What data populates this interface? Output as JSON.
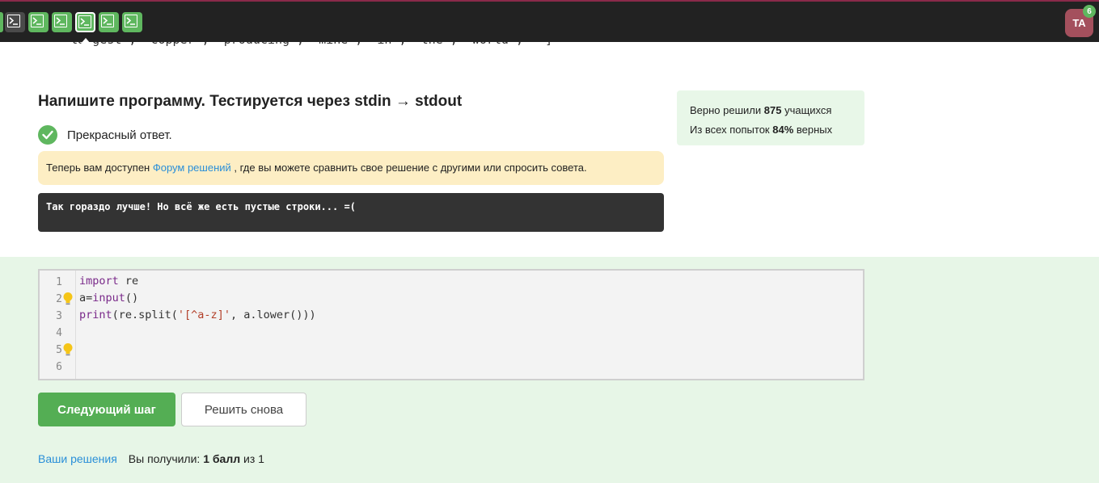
{
  "topbar": {
    "steps": [
      {
        "state": "done",
        "kind": "code"
      },
      {
        "state": "dark",
        "kind": "code"
      },
      {
        "state": "done",
        "kind": "code"
      },
      {
        "state": "done",
        "kind": "code"
      },
      {
        "state": "done-active",
        "kind": "code"
      },
      {
        "state": "done",
        "kind": "code"
      },
      {
        "state": "done",
        "kind": "code"
      }
    ],
    "avatar_initials": "TA",
    "notification_count": "6"
  },
  "previous_output_line": "  'largest', 'copper', 'producing', 'mine', 'in', 'the', 'world', '']",
  "task": {
    "title": "Напишите программу. Тестируется через stdin → stdout",
    "status_text": "Прекрасный ответ.",
    "notice_before": "Теперь вам доступен ",
    "notice_link": "Форум решений",
    "notice_after": " , где вы можете сравнить свое решение с другими или спросить совета.",
    "feedback": "Так гораздо лучше! Но всё же есть пустые строки... =("
  },
  "stats": {
    "solved_prefix": "Верно решили ",
    "solved_count": "875",
    "solved_suffix": " учащихся",
    "attempts_prefix": "Из всех попыток ",
    "attempts_percent": "84%",
    "attempts_suffix": " верных"
  },
  "editor": {
    "line_numbers": [
      "1",
      "2",
      "3",
      "4",
      "5",
      "6"
    ],
    "lines": [
      [
        {
          "t": "import",
          "c": "kw"
        },
        {
          "t": " re",
          "c": ""
        }
      ],
      [
        {
          "t": "a=",
          "c": ""
        },
        {
          "t": "input",
          "c": "kw"
        },
        {
          "t": "()",
          "c": ""
        }
      ],
      [
        {
          "t": "print",
          "c": "kw"
        },
        {
          "t": "(re.split(",
          "c": ""
        },
        {
          "t": "'[^a-z]'",
          "c": "str"
        },
        {
          "t": ", a.lower()))",
          "c": ""
        }
      ],
      [],
      [],
      []
    ],
    "hint_lines": [
      2,
      5
    ]
  },
  "actions": {
    "next_label": "Следующий шаг",
    "retry_label": "Решить снова"
  },
  "footer": {
    "solutions_link": "Ваши решения",
    "score_prefix": "Вы получили: ",
    "score_value": "1 балл",
    "score_suffix": " из 1"
  },
  "colors": {
    "accent_green": "#54ae54",
    "link_blue": "#2a8fd8",
    "topbar_bg": "#222222"
  }
}
